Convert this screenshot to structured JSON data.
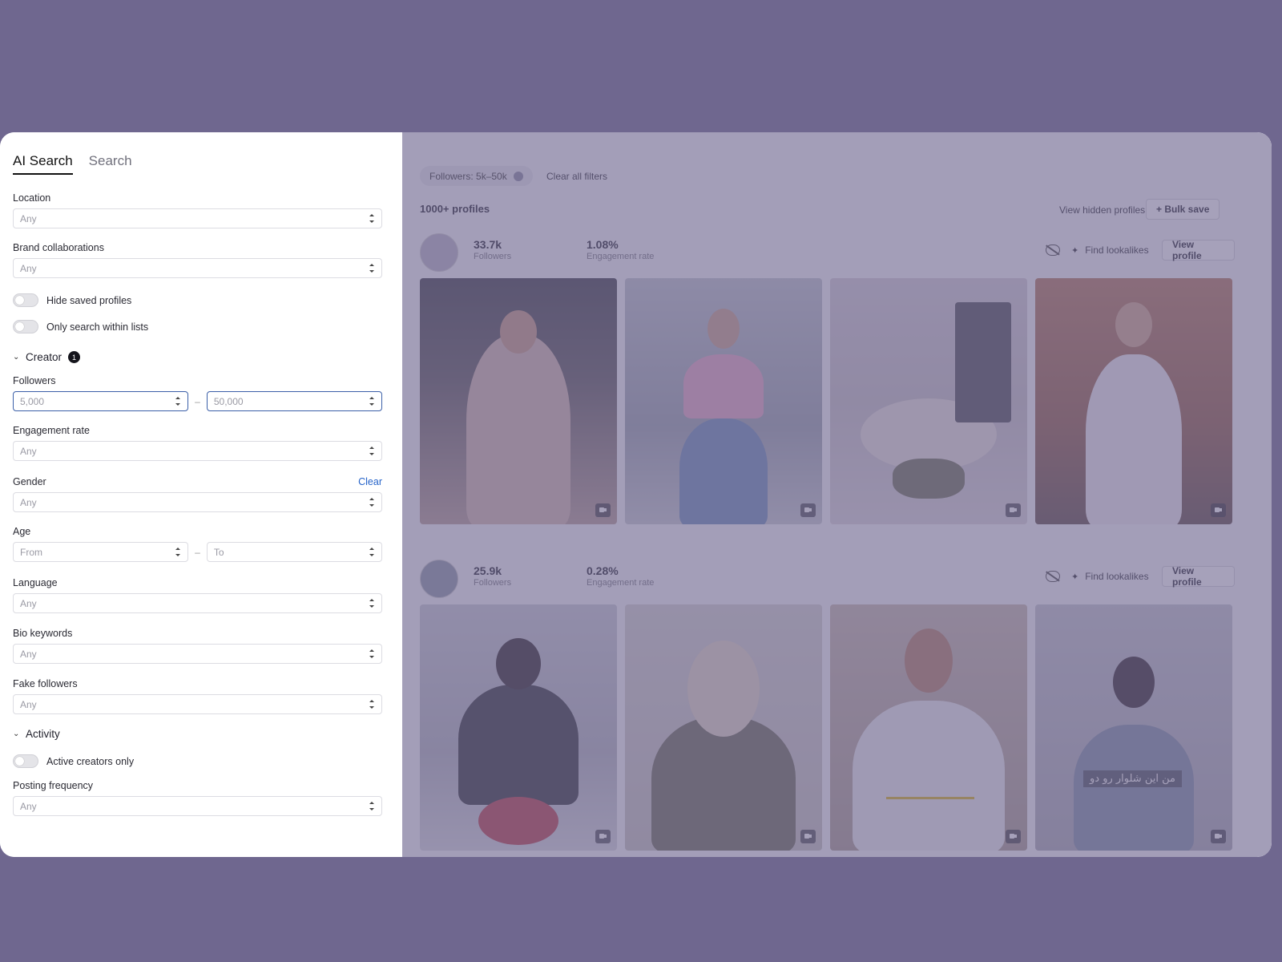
{
  "tabs": [
    {
      "label": "AI Search"
    },
    {
      "label": "Search"
    }
  ],
  "filters": {
    "location": {
      "label": "Location",
      "value": "Any"
    },
    "brand": {
      "label": "Brand collaborations",
      "value": "Any"
    },
    "hide_saved": "Hide saved profiles",
    "only_lists": "Only search within lists",
    "creator_section": {
      "label": "Creator",
      "badge": "1"
    },
    "followers": {
      "label": "Followers",
      "from": "5,000",
      "to": "50,000"
    },
    "engagement": {
      "label": "Engagement rate",
      "value": "Any"
    },
    "gender": {
      "label": "Gender",
      "value": "Any",
      "clear": "Clear"
    },
    "age": {
      "label": "Age",
      "from": "From",
      "to": "To"
    },
    "language": {
      "label": "Language",
      "value": "Any"
    },
    "bio": {
      "label": "Bio keywords",
      "value": "Any"
    },
    "fake": {
      "label": "Fake followers",
      "value": "Any"
    },
    "activity_section": {
      "label": "Activity"
    },
    "active_only": "Active creators only",
    "posting": {
      "label": "Posting frequency",
      "value": "Any"
    },
    "dash": "–"
  },
  "results": {
    "chip": "Followers: 5k–50k",
    "clear_all": "Clear all filters",
    "count": "1000+ profiles",
    "view_hidden": "View hidden profiles",
    "bulk_save": "+ Bulk save",
    "find_lookalikes": "Find lookalikes",
    "view_profile": "View profile",
    "profiles": [
      {
        "followers": "33.7k",
        "followers_label": "Followers",
        "engagement": "1.08%",
        "engagement_label": "Engagement rate"
      },
      {
        "followers": "25.9k",
        "followers_label": "Followers",
        "engagement": "0.28%",
        "engagement_label": "Engagement rate"
      }
    ],
    "overlay_text": "من این شلوار رو دو"
  }
}
